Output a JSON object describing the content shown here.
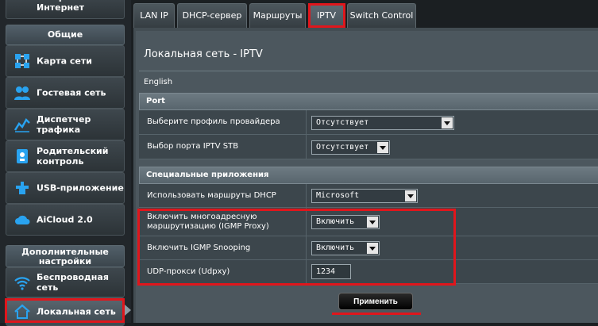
{
  "sidebar": {
    "top_item_label": "настройка\nИнтернет",
    "section_general": "Общие",
    "items": [
      {
        "label": "Карта сети",
        "icon": "network-map-icon"
      },
      {
        "label": "Гостевая сеть",
        "icon": "guest-network-icon"
      },
      {
        "label": "Диспетчер\nтрафика",
        "icon": "traffic-manager-icon"
      },
      {
        "label": "Родительский\nконтроль",
        "icon": "parental-control-icon"
      },
      {
        "label": "USB-приложение",
        "icon": "usb-icon"
      },
      {
        "label": "AiCloud 2.0",
        "icon": "cloud-icon"
      }
    ],
    "section_advanced": "Дополнительные\nнастройки",
    "advanced_items": [
      {
        "label": "Беспроводная\nсеть",
        "icon": "wifi-icon"
      },
      {
        "label": "Локальная сеть",
        "icon": "home-icon"
      }
    ]
  },
  "tabs": [
    {
      "label": "LAN IP"
    },
    {
      "label": "DHCP-сервер"
    },
    {
      "label": "Маршруты"
    },
    {
      "label": "IPTV"
    },
    {
      "label": "Switch Control"
    }
  ],
  "page": {
    "title": "Локальная сеть - IPTV",
    "language": "English"
  },
  "port": {
    "header": "Port",
    "isp_profile_label": "Выберите профиль провайдера",
    "isp_profile_value": "Отсутствует",
    "stb_port_label": "Выбор порта IPTV STB",
    "stb_port_value": "Отсутствует"
  },
  "special": {
    "header": "Специальные приложения",
    "dhcp_routes_label": "Использовать маршруты DHCP",
    "dhcp_routes_value": "Microsoft",
    "igmp_proxy_label": "Включить многоадресную маршрутизацию (IGMP Proxy)",
    "igmp_proxy_value": "Включить",
    "igmp_snooping_label": "Включить IGMP Snooping",
    "igmp_snooping_value": "Включить",
    "udpxy_label": "UDP-прокси (Udpxy)",
    "udpxy_value": "1234"
  },
  "apply_label": "Применить",
  "colors": {
    "highlight": "#e0161c",
    "background": "#1b1f22"
  }
}
